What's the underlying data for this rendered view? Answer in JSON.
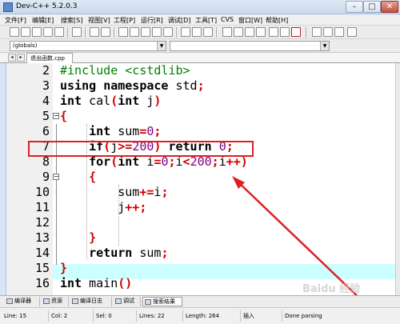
{
  "window": {
    "title": "Dev-C++ 5.2.0.3"
  },
  "menu": [
    "文件[F]",
    "编辑[E]",
    "搜索[S]",
    "视图[V]",
    "工程[P]",
    "运行[R]",
    "调试[D]",
    "工具[T]",
    "CVS",
    "窗口[W]",
    "帮助[H]"
  ],
  "toolbar": {
    "scope_value": "(globals)"
  },
  "tabs": {
    "file": "退出函数.cpp"
  },
  "editor": {
    "lines": [
      {
        "num": "2",
        "code": "#include <cstdlib>"
      },
      {
        "num": "3",
        "code": "using namespace std;"
      },
      {
        "num": "4",
        "code": "int cal(int j)"
      },
      {
        "num": "5",
        "code": "{"
      },
      {
        "num": "6",
        "code": "    int sum=0;"
      },
      {
        "num": "7",
        "code": "    if(j>=200) return 0;"
      },
      {
        "num": "8",
        "code": "    for(int i=0;i<200;i++)"
      },
      {
        "num": "9",
        "code": "    {"
      },
      {
        "num": "10",
        "code": "        sum+=i;"
      },
      {
        "num": "11",
        "code": "        j++;"
      },
      {
        "num": "12",
        "code": ""
      },
      {
        "num": "13",
        "code": "    }"
      },
      {
        "num": "14",
        "code": "    return sum;"
      },
      {
        "num": "15",
        "code": "}"
      },
      {
        "num": "16",
        "code": "int main()"
      }
    ]
  },
  "bottom_tabs": [
    "编译器",
    "资源",
    "编译日志",
    "调试",
    "搜索结果"
  ],
  "status": {
    "line": "Line:  15",
    "col": "Col:  2",
    "sel": "Sel:  0",
    "lines": "Lines:  22",
    "length": "Length:  264",
    "mode": "插入",
    "message": "Done parsing"
  },
  "watermark": "Baidu 经验",
  "colors": {
    "keyword": "#000000",
    "preprocessor": "#008000",
    "number": "#800080",
    "operator": "#d00000",
    "annotation": "#e02020",
    "current_line": "#ccffff"
  }
}
